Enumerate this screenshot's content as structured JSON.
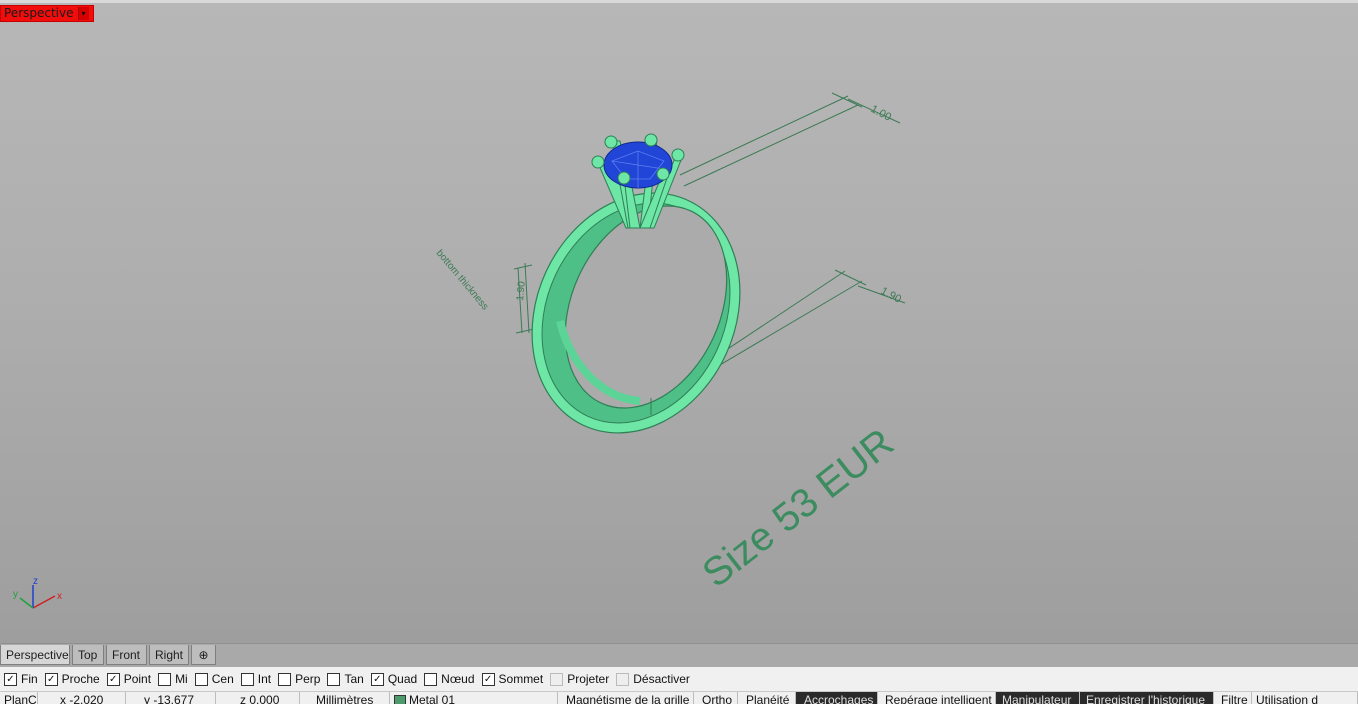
{
  "viewport": {
    "label": "Perspective",
    "menu_arrow": "▾",
    "annotations": {
      "dim_top": "1.00",
      "dim_bottom": "1.90",
      "dim_side": "1.90",
      "side_label": "bottom thickness",
      "size_text": "Size 53 EUR"
    },
    "axes": {
      "x": "x",
      "y": "y",
      "z": "z"
    },
    "colors": {
      "metal": "#6ee6a6",
      "metal_edge": "#2f7f55",
      "gem": "#2145d6",
      "dim_line": "#3c7a55",
      "label_bg": "#f20d0d"
    }
  },
  "tabs": [
    {
      "label": "Perspective",
      "active": true
    },
    {
      "label": "Top",
      "active": false
    },
    {
      "label": "Front",
      "active": false
    },
    {
      "label": "Right",
      "active": false
    }
  ],
  "tab_add_icon": "⊕",
  "osnaps": [
    {
      "label": "Fin",
      "checked": true
    },
    {
      "label": "Proche",
      "checked": true
    },
    {
      "label": "Point",
      "checked": true
    },
    {
      "label": "Mi",
      "checked": false
    },
    {
      "label": "Cen",
      "checked": false
    },
    {
      "label": "Int",
      "checked": false
    },
    {
      "label": "Perp",
      "checked": false
    },
    {
      "label": "Tan",
      "checked": false
    },
    {
      "label": "Quad",
      "checked": true
    },
    {
      "label": "Nœud",
      "checked": false
    },
    {
      "label": "Sommet",
      "checked": true
    },
    {
      "label": "Projeter",
      "checked": false,
      "disabled": true
    },
    {
      "label": "Désactiver",
      "checked": false,
      "disabled": true
    }
  ],
  "status": {
    "plane": "PlanC",
    "x": "x -2.020",
    "y": "y -13.677",
    "z": "z 0.000",
    "units": "Millimètres",
    "layer": "Metal 01",
    "grid_snap": "Magnétisme de la grille",
    "ortho": "Ortho",
    "planar": "Planéité",
    "osnap": "Accrochages",
    "smarttrack": "Repérage intelligent",
    "gumball": "Manipulateur",
    "history": "Enregistrer l'historique",
    "filter": "Filtre",
    "usage": "Utilisation d"
  }
}
